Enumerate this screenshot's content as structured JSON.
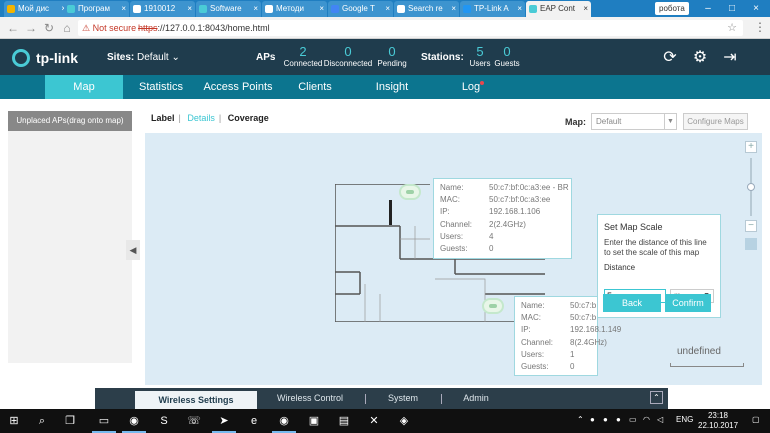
{
  "browser": {
    "tabs": [
      {
        "label": "Мой дис",
        "color": "#f4b400",
        "active": false
      },
      {
        "label": "Програм",
        "color": "#4acbd6",
        "active": false
      },
      {
        "label": "1910012",
        "color": "#ffffff",
        "active": false
      },
      {
        "label": "Software",
        "color": "#4acbd6",
        "active": false
      },
      {
        "label": "Методи",
        "color": "#ffffff",
        "active": false
      },
      {
        "label": "Google Т",
        "color": "#4285f4",
        "active": false
      },
      {
        "label": "Search re",
        "color": "#ffffff",
        "active": false
      },
      {
        "label": "TP-Link A",
        "color": "#2196f3",
        "active": false
      },
      {
        "label": "EAP Cont",
        "color": "#4acbd6",
        "active": true
      }
    ],
    "profile": "робота",
    "not_secure": "Not secure",
    "url_proto": "https",
    "url_rest": "://127.0.0.1:8043/home.html"
  },
  "header": {
    "logo_text": "tp-link",
    "sites_label": "Sites:",
    "sites_value": "Default",
    "aps_label": "APs",
    "aps": [
      {
        "n": "2",
        "l": "Connected"
      },
      {
        "n": "0",
        "l": "Disconnected"
      },
      {
        "n": "0",
        "l": "Pending"
      }
    ],
    "stations_label": "Stations:",
    "stations": [
      {
        "n": "5",
        "l": "Users"
      },
      {
        "n": "0",
        "l": "Guests"
      }
    ]
  },
  "nav": {
    "items": [
      "Map",
      "Statistics",
      "Access Points",
      "Clients",
      "Insight",
      "Log"
    ],
    "active": "Map"
  },
  "leftpanel": {
    "unplaced": "Unplaced APs(drag onto map)"
  },
  "maptoolbar": {
    "label": "Label",
    "details": "Details",
    "coverage": "Coverage",
    "map_label": "Map:",
    "map_value": "Default",
    "configure": "Configure Maps"
  },
  "ap1": {
    "rows": [
      {
        "k": "Name:",
        "v": "50:c7:bf:0c:a3:ee - BR"
      },
      {
        "k": "MAC:",
        "v": "50:c7:bf:0c:a3:ee"
      },
      {
        "k": "IP:",
        "v": "192.168.1.106"
      },
      {
        "k": "Channel:",
        "v": "2(2.4GHz)"
      },
      {
        "k": "Users:",
        "v": "4"
      },
      {
        "k": "Guests:",
        "v": "0"
      }
    ]
  },
  "ap2": {
    "rows": [
      {
        "k": "Name:",
        "v": "50:c7:b"
      },
      {
        "k": "MAC:",
        "v": "50:c7:b"
      },
      {
        "k": "IP:",
        "v": "192.168.1.149"
      },
      {
        "k": "Channel:",
        "v": "8(2.4GHz)"
      },
      {
        "k": "Users:",
        "v": "1"
      },
      {
        "k": "Guests:",
        "v": "0"
      }
    ]
  },
  "scale_dialog": {
    "title": "Set Map Scale",
    "desc": "Enter the distance of this line to set the scale of this map",
    "distance_label": "Distance",
    "distance_value": "5",
    "unit": "m",
    "back": "Back",
    "confirm": "Confirm"
  },
  "scale_undefined": "undefined",
  "bottombar": {
    "tabs": [
      "Wireless Settings",
      "Wireless Control",
      "System",
      "Admin"
    ],
    "active": "Wireless Settings"
  },
  "taskbar": {
    "lang": "ENG",
    "time": "23:18",
    "date": "22.10.2017"
  }
}
